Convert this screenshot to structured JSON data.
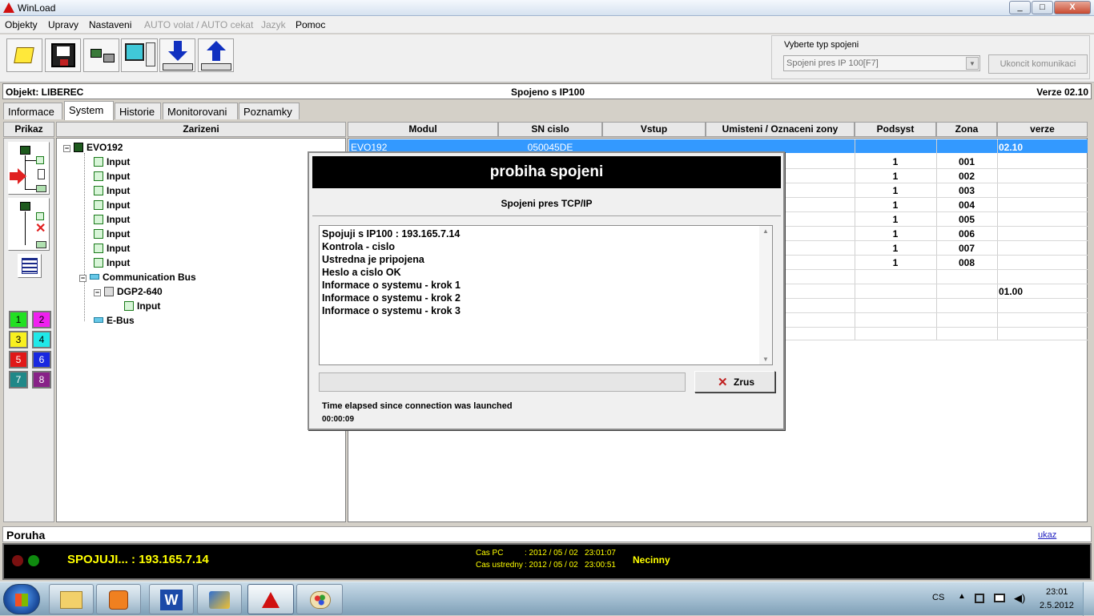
{
  "window": {
    "title": "WinLoad",
    "min": "_",
    "max": "□",
    "close": "X"
  },
  "menu": [
    "Objekty",
    "Upravy",
    "Nastaveni",
    "AUTO volat / AUTO cekat",
    "Jazyk",
    "Pomoc"
  ],
  "connection": {
    "label": "Vyberte typ spojeni",
    "selected": "Spojeni pres IP 100[F7]",
    "end_button": "Ukoncit komunikaci"
  },
  "objbar": {
    "object": "Objekt: LIBEREC",
    "status": "Spojeno s IP100",
    "version": "Verze 02.10"
  },
  "tabs": [
    "Informace",
    "System",
    "Historie",
    "Monitorovani",
    "Poznamky"
  ],
  "left_headers": {
    "prikaz": "Prikaz",
    "zarizeni": "Zarizeni"
  },
  "tree": [
    {
      "label": "EVO192"
    },
    {
      "label": "Input"
    },
    {
      "label": "Input"
    },
    {
      "label": "Input"
    },
    {
      "label": "Input"
    },
    {
      "label": "Input"
    },
    {
      "label": "Input"
    },
    {
      "label": "Input"
    },
    {
      "label": "Input"
    },
    {
      "label": "Communication Bus"
    },
    {
      "label": "DGP2-640"
    },
    {
      "label": "Input"
    },
    {
      "label": "E-Bus"
    }
  ],
  "numbers": [
    "1",
    "2",
    "3",
    "4",
    "5",
    "6",
    "7",
    "8"
  ],
  "grid": {
    "columns": [
      "Modul",
      "SN cislo",
      "Vstup",
      "Umisteni / Oznaceni zony",
      "Podsyst",
      "Zona",
      "verze"
    ],
    "selected_row": {
      "modul": "EVO192",
      "sn": "050045DE",
      "verze": "02.10"
    },
    "rows": [
      {
        "podsyst": "1",
        "zona": "001"
      },
      {
        "podsyst": "1",
        "zona": "002"
      },
      {
        "podsyst": "1",
        "zona": "003"
      },
      {
        "podsyst": "1",
        "zona": "004"
      },
      {
        "podsyst": "1",
        "zona": "005"
      },
      {
        "podsyst": "1",
        "zona": "006"
      },
      {
        "podsyst": "1",
        "zona": "007"
      },
      {
        "podsyst": "1",
        "zona": "008"
      }
    ],
    "extra_verze": "01.00"
  },
  "dialog": {
    "title": "probiha spojeni",
    "subtitle": "Spojeni pres TCP/IP",
    "log": [
      "Spojuji s IP100 : 193.165.7.14",
      "Kontrola - cislo",
      "Ustredna je pripojena",
      "Heslo a cislo OK",
      "Informace o systemu - krok 1",
      "Informace o systemu - krok 2",
      "Informace o systemu - krok 3"
    ],
    "cancel": "Zrus",
    "elapsed_label": "Time elapsed since connection was launched",
    "elapsed": "00:00:09"
  },
  "status": {
    "poruca": "Poruha",
    "ukaz": "ukaz",
    "connecting": "SPOJUJI... : 193.165.7.14",
    "cas_pc_label": "Cas PC",
    "cas_pc": ": 2012 / 05 / 02   23:01:07",
    "cas_ustredny_label": "Cas ustredny",
    "cas_ustredny": ": 2012 / 05 / 02   23:00:51",
    "state": "Necinny"
  },
  "taskbar": {
    "lang": "CS",
    "time": "23:01",
    "date": "2.5.2012"
  },
  "colors": {
    "accent": "#3399ff",
    "status_text": "#ffff00"
  }
}
